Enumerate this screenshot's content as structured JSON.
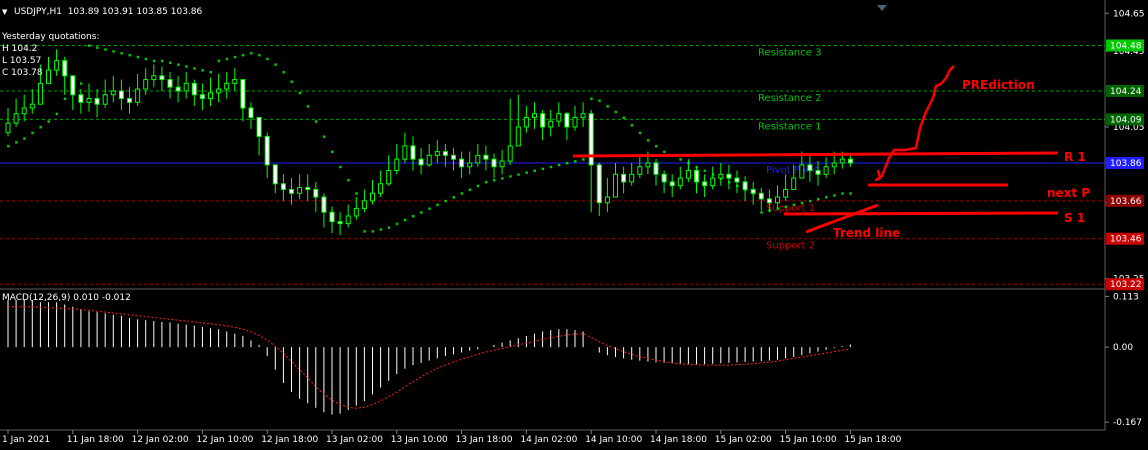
{
  "header": {
    "symbol_line": "USDJPY,H1  103.89 103.91 103.85 103.86",
    "yq_title": "Yesterday quotations:",
    "yq_h": "H 104.2",
    "yq_l": "L 103.57",
    "yq_c": "C 103.78"
  },
  "macd_header": "MACD(12,26,9) 0.010 -0.012",
  "colors": {
    "bull": "#ffffff",
    "bear": "#ffffff",
    "wick": "#00ff00",
    "sar": "#00c800",
    "resistance": "#00c800",
    "support": "#c80000",
    "current_line": "#1e1eff",
    "annotation": "#ff0000",
    "grid": "#202020",
    "macd_hist": "#ffffff",
    "macd_signal": "#ff2020"
  },
  "chart_data": [
    {
      "type": "candlestick",
      "title": "USDJPY,H1",
      "ylim": [
        103.2,
        104.72
      ],
      "price_axis_ticks": [
        "104.65",
        "104.45",
        "104.05",
        "103.65",
        "103.25"
      ],
      "price_tags": [
        {
          "label": "104.48",
          "value": 104.48,
          "color": "#00c800"
        },
        {
          "label": "104.24",
          "value": 104.24,
          "color": "#006400"
        },
        {
          "label": "104.09",
          "value": 104.09,
          "color": "#006400"
        },
        {
          "label": "103.86",
          "value": 103.86,
          "color": "#1e1eff"
        },
        {
          "label": "103.66",
          "value": 103.66,
          "color": "#8b0000"
        },
        {
          "label": "103.46",
          "value": 103.46,
          "color": "#c80000"
        },
        {
          "label": "103.22",
          "value": 103.22,
          "color": "#c80000"
        }
      ],
      "levels": [
        {
          "name": "Resistance 3",
          "value": 104.48,
          "kind": "resistance"
        },
        {
          "name": "Resistance 2",
          "value": 104.24,
          "kind": "resistance"
        },
        {
          "name": "Resistance 1",
          "value": 104.09,
          "kind": "resistance"
        },
        {
          "name": "Pivot Point",
          "value": 103.86,
          "kind": "pivot"
        },
        {
          "name": "Support 1",
          "value": 103.66,
          "kind": "support"
        },
        {
          "name": "Support 2",
          "value": 103.46,
          "kind": "support"
        },
        {
          "name": "",
          "value": 103.22,
          "kind": "support"
        }
      ],
      "x_labels": [
        "1 Jan 2021",
        "11 Jan 18:00",
        "12 Jan 02:00",
        "12 Jan 10:00",
        "12 Jan 18:00",
        "13 Jan 02:00",
        "13 Jan 10:00",
        "13 Jan 18:00",
        "14 Jan 02:00",
        "14 Jan 10:00",
        "14 Jan 18:00",
        "15 Jan 02:00",
        "15 Jan 10:00",
        "15 Jan 18:00"
      ],
      "x_label_bar_index": [
        0,
        8,
        16,
        24,
        32,
        40,
        48,
        56,
        64,
        72,
        80,
        88,
        96,
        104
      ],
      "close": [
        104.07,
        104.12,
        104.15,
        104.17,
        104.28,
        104.35,
        104.4,
        104.32,
        104.22,
        104.18,
        104.2,
        104.17,
        104.22,
        104.24,
        104.2,
        104.18,
        104.25,
        104.3,
        104.32,
        104.3,
        104.26,
        104.24,
        104.28,
        104.22,
        104.2,
        104.23,
        104.25,
        104.28,
        104.3,
        104.15,
        104.1,
        104.0,
        103.85,
        103.75,
        103.72,
        103.7,
        103.73,
        103.72,
        103.68,
        103.6,
        103.55,
        103.54,
        103.58,
        103.62,
        103.66,
        103.7,
        103.75,
        103.82,
        103.88,
        103.95,
        103.88,
        103.85,
        103.9,
        103.92,
        103.9,
        103.88,
        103.84,
        103.86,
        103.9,
        103.88,
        103.84,
        103.87,
        103.95,
        104.05,
        104.1,
        104.12,
        104.05,
        104.08,
        104.12,
        104.05,
        104.1,
        104.12,
        103.85,
        103.65,
        103.68,
        103.8,
        103.76,
        103.8,
        103.84,
        103.86,
        103.8,
        103.76,
        103.74,
        103.78,
        103.82,
        103.76,
        103.74,
        103.78,
        103.8,
        103.78,
        103.76,
        103.72,
        103.7,
        103.67,
        103.65,
        103.68,
        103.72,
        103.78,
        103.85,
        103.82,
        103.8,
        103.84,
        103.86,
        103.88,
        103.86
      ],
      "high": [
        104.15,
        104.2,
        104.22,
        104.25,
        104.38,
        104.42,
        104.46,
        104.42,
        104.3,
        104.25,
        104.28,
        104.25,
        104.3,
        104.32,
        104.3,
        104.26,
        104.33,
        104.36,
        104.38,
        104.37,
        104.34,
        104.32,
        104.34,
        104.3,
        104.28,
        104.31,
        104.33,
        104.34,
        104.36,
        104.3,
        104.18,
        104.1,
        104.02,
        103.84,
        103.8,
        103.78,
        103.8,
        103.8,
        103.76,
        103.7,
        103.63,
        103.6,
        103.64,
        103.68,
        103.72,
        103.77,
        103.82,
        103.9,
        103.96,
        104.02,
        104.0,
        103.94,
        103.96,
        103.98,
        103.96,
        103.94,
        103.92,
        103.92,
        103.96,
        103.95,
        103.91,
        103.93,
        104.2,
        104.22,
        104.16,
        104.18,
        104.14,
        104.14,
        104.18,
        104.13,
        104.16,
        104.18,
        104.14,
        103.86,
        103.78,
        103.86,
        103.84,
        103.86,
        103.9,
        103.92,
        103.88,
        103.82,
        103.8,
        103.84,
        103.88,
        103.84,
        103.8,
        103.84,
        103.86,
        103.85,
        103.82,
        103.79,
        103.76,
        103.73,
        103.72,
        103.74,
        103.8,
        103.85,
        103.92,
        103.9,
        103.87,
        103.89,
        103.92,
        103.92,
        103.91
      ],
      "low": [
        104.0,
        104.05,
        104.08,
        104.12,
        104.2,
        104.28,
        104.32,
        104.22,
        104.14,
        104.12,
        104.13,
        104.1,
        104.15,
        104.18,
        104.14,
        104.12,
        104.16,
        104.22,
        104.26,
        104.24,
        104.2,
        104.18,
        104.2,
        104.16,
        104.14,
        104.16,
        104.18,
        104.2,
        104.24,
        104.08,
        104.04,
        103.9,
        103.78,
        103.7,
        103.66,
        103.64,
        103.67,
        103.66,
        103.6,
        103.52,
        103.49,
        103.48,
        103.52,
        103.56,
        103.6,
        103.64,
        103.68,
        103.74,
        103.8,
        103.86,
        103.82,
        103.8,
        103.84,
        103.86,
        103.84,
        103.82,
        103.78,
        103.8,
        103.84,
        103.82,
        103.78,
        103.8,
        103.85,
        103.95,
        104.02,
        104.04,
        103.98,
        104.0,
        104.05,
        103.98,
        104.03,
        104.05,
        103.6,
        103.58,
        103.6,
        103.72,
        103.7,
        103.74,
        103.78,
        103.8,
        103.74,
        103.7,
        103.68,
        103.72,
        103.76,
        103.7,
        103.68,
        103.72,
        103.74,
        103.72,
        103.7,
        103.66,
        103.64,
        103.61,
        103.6,
        103.62,
        103.66,
        103.72,
        103.79,
        103.76,
        103.74,
        103.78,
        103.8,
        103.83,
        103.84
      ],
      "parabolic_sar": [
        103.95,
        103.97,
        103.99,
        104.02,
        104.05,
        104.08,
        104.12,
        104.2,
        104.26,
        104.28,
        104.48,
        104.47,
        104.46,
        104.45,
        104.44,
        104.43,
        104.42,
        104.41,
        104.4,
        104.4,
        104.39,
        104.38,
        104.37,
        104.36,
        104.35,
        104.34,
        104.4,
        104.41,
        104.42,
        104.43,
        104.44,
        104.43,
        104.41,
        104.38,
        104.34,
        104.29,
        104.23,
        104.16,
        104.08,
        104.0,
        103.92,
        103.84,
        103.77,
        103.7,
        103.5,
        103.5,
        103.51,
        103.52,
        103.54,
        103.56,
        103.58,
        103.6,
        103.62,
        103.64,
        103.66,
        103.68,
        103.7,
        103.72,
        103.74,
        103.76,
        103.77,
        103.78,
        103.79,
        103.8,
        103.81,
        103.82,
        103.83,
        103.84,
        103.85,
        103.86,
        103.87,
        103.88,
        104.2,
        104.19,
        104.16,
        104.13,
        104.1,
        104.06,
        104.02,
        103.98,
        103.95,
        103.92,
        103.9,
        103.88,
        103.86,
        103.84,
        103.82,
        103.8,
        103.78,
        103.76,
        103.74,
        103.72,
        103.7,
        103.6,
        103.61,
        103.62,
        103.63,
        103.64,
        103.65,
        103.66,
        103.67,
        103.68,
        103.69,
        103.7,
        103.7
      ]
    },
    {
      "type": "histogram",
      "title": "MACD(12,26,9) 0.010 -0.012",
      "ylim": [
        -0.18,
        0.125
      ],
      "y_ticks": [
        "0.113",
        "0.00",
        "-0.167"
      ],
      "histogram": [
        0.105,
        0.105,
        0.105,
        0.105,
        0.1,
        0.1,
        0.1,
        0.095,
        0.09,
        0.085,
        0.08,
        0.078,
        0.075,
        0.072,
        0.07,
        0.065,
        0.062,
        0.06,
        0.058,
        0.056,
        0.055,
        0.052,
        0.05,
        0.048,
        0.045,
        0.042,
        0.04,
        0.035,
        0.03,
        0.025,
        0.015,
        0.005,
        -0.02,
        -0.05,
        -0.08,
        -0.1,
        -0.115,
        -0.125,
        -0.135,
        -0.145,
        -0.15,
        -0.148,
        -0.14,
        -0.13,
        -0.12,
        -0.105,
        -0.09,
        -0.075,
        -0.06,
        -0.048,
        -0.04,
        -0.035,
        -0.03,
        -0.025,
        -0.02,
        -0.016,
        -0.012,
        -0.008,
        -0.005,
        0.0,
        0.005,
        0.01,
        0.015,
        0.02,
        0.025,
        0.03,
        0.035,
        0.038,
        0.04,
        0.04,
        0.038,
        0.035,
        0.0,
        -0.012,
        -0.018,
        -0.022,
        -0.025,
        -0.028,
        -0.03,
        -0.032,
        -0.034,
        -0.035,
        -0.036,
        -0.037,
        -0.038,
        -0.038,
        -0.038,
        -0.037,
        -0.036,
        -0.035,
        -0.034,
        -0.033,
        -0.032,
        -0.031,
        -0.03,
        -0.028,
        -0.025,
        -0.022,
        -0.018,
        -0.014,
        -0.01,
        -0.006,
        -0.002,
        0.002,
        0.006
      ],
      "signal": [
        0.09,
        0.09,
        0.09,
        0.09,
        0.089,
        0.088,
        0.087,
        0.086,
        0.085,
        0.084,
        0.082,
        0.08,
        0.078,
        0.076,
        0.074,
        0.072,
        0.07,
        0.068,
        0.066,
        0.064,
        0.062,
        0.06,
        0.058,
        0.056,
        0.054,
        0.052,
        0.05,
        0.047,
        0.044,
        0.04,
        0.034,
        0.026,
        0.016,
        0.002,
        -0.014,
        -0.032,
        -0.05,
        -0.068,
        -0.088,
        -0.105,
        -0.118,
        -0.128,
        -0.134,
        -0.136,
        -0.134,
        -0.128,
        -0.12,
        -0.11,
        -0.1,
        -0.088,
        -0.077,
        -0.066,
        -0.056,
        -0.047,
        -0.04,
        -0.033,
        -0.027,
        -0.021,
        -0.016,
        -0.011,
        -0.007,
        -0.003,
        0.001,
        0.005,
        0.009,
        0.013,
        0.017,
        0.021,
        0.024,
        0.027,
        0.029,
        0.03,
        0.022,
        0.012,
        0.004,
        -0.004,
        -0.01,
        -0.016,
        -0.021,
        -0.025,
        -0.029,
        -0.032,
        -0.035,
        -0.037,
        -0.038,
        -0.039,
        -0.04,
        -0.04,
        -0.04,
        -0.04,
        -0.039,
        -0.038,
        -0.037,
        -0.035,
        -0.033,
        -0.031,
        -0.028,
        -0.025,
        -0.022,
        -0.019,
        -0.016,
        -0.013,
        -0.01,
        -0.007,
        -0.004
      ]
    }
  ],
  "annotations": {
    "prediction": "PREdiction",
    "r1": "R 1",
    "next_p": "next P",
    "s1": "S 1",
    "trend_line": "Trend line"
  }
}
